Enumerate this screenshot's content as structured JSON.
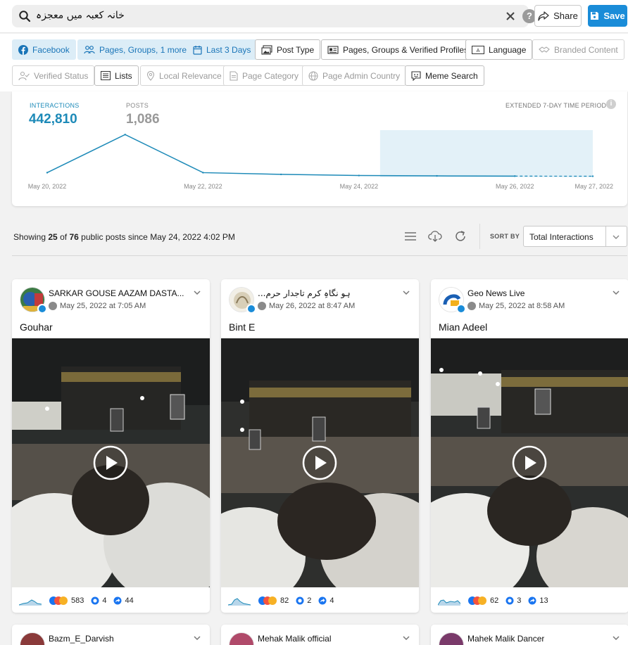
{
  "search": {
    "query": "خانہ کعبہ میں معجزہ"
  },
  "actions": {
    "share": "Share",
    "save": "Save"
  },
  "filters": [
    {
      "label": "Facebook",
      "state": "active"
    },
    {
      "label": "Pages, Groups, 1 more",
      "state": "active"
    },
    {
      "label": "Last 3 Days",
      "state": "active"
    },
    {
      "label": "Post Type",
      "state": "normal"
    },
    {
      "label": "Pages, Groups & Verified Profiles",
      "state": "normal"
    },
    {
      "label": "Language",
      "state": "normal"
    },
    {
      "label": "Branded Content",
      "state": "disabled"
    },
    {
      "label": "Verified Status",
      "state": "disabled"
    },
    {
      "label": "Lists",
      "state": "normal"
    },
    {
      "label": "Local Relevance",
      "state": "disabled"
    },
    {
      "label": "Page Category",
      "state": "disabled"
    },
    {
      "label": "Page Admin Country",
      "state": "disabled"
    },
    {
      "label": "Meme Search",
      "state": "normal"
    }
  ],
  "summary": {
    "interactions_label": "INTERACTIONS",
    "interactions_value": "442,810",
    "posts_label": "POSTS",
    "posts_value": "1,086",
    "period_label": "EXTENDED 7-DAY TIME PERIOD"
  },
  "chart_data": {
    "type": "line",
    "x": [
      "May 20, 2022",
      "May 21, 2022",
      "May 22, 2022",
      "May 23, 2022",
      "May 24, 2022",
      "May 25, 2022",
      "May 26, 2022",
      "May 27, 2022"
    ],
    "tick_labels": [
      "May 20, 2022",
      "May 22, 2022",
      "May 24, 2022",
      "May 26, 2022",
      "May 27, 2022"
    ],
    "series": [
      {
        "values": [
          4000,
          37000,
          4000,
          2500,
          1500,
          1200,
          1000,
          900
        ]
      }
    ],
    "highlight_range": [
      "May 24, 2022",
      "May 27, 2022"
    ],
    "dashed_after": "May 26, 2022",
    "ylim": [
      0,
      50000
    ],
    "grid": false,
    "color": "#1d8ab8",
    "highlight_color": "#e3f1f8"
  },
  "results": {
    "prefix": "Showing",
    "shown": "25",
    "of": "of",
    "total": "76",
    "suffix": "public posts since May 24, 2022 4:02 PM",
    "sort_by_label": "SORT BY",
    "sort_value": "Total Interactions"
  },
  "posts": [
    {
      "name": "SARKAR GOUSE AAZAM DASTA...",
      "date": "May 25, 2022 at 7:05 AM",
      "title": "Gouhar",
      "reactions": "583",
      "comments": "4",
      "shares": "44",
      "avatar_color": "#2f6f3a"
    },
    {
      "name": "...ہو نگاہِ کرم تاجدارِ حرم",
      "date": "May 26, 2022 at 8:47 AM",
      "title": "Bint E",
      "reactions": "82",
      "comments": "2",
      "shares": "4",
      "avatar_color": "#d8d2c4"
    },
    {
      "name": "Geo News Live",
      "date": "May 25, 2022 at 8:58 AM",
      "title": "Mian Adeel",
      "reactions": "62",
      "comments": "3",
      "shares": "13",
      "avatar_color": "#ffffff"
    },
    {
      "name": "Bazm_E_Darvish",
      "avatar_color": "#8a3a3a"
    },
    {
      "name": "Mehak Malik official",
      "avatar_color": "#b04a6a"
    },
    {
      "name": "Mahek Malik Dancer",
      "avatar_color": "#7a3a6a"
    }
  ]
}
